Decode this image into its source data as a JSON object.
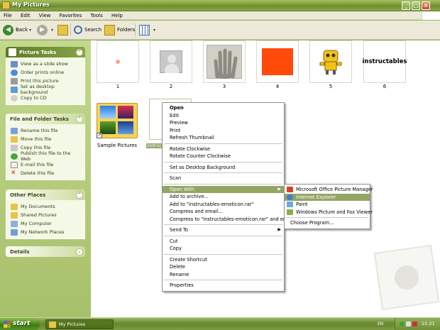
{
  "window": {
    "title": "My Pictures"
  },
  "menubar": {
    "items": [
      "File",
      "Edit",
      "View",
      "Favorites",
      "Tools",
      "Help"
    ]
  },
  "toolbar": {
    "back": "Back",
    "search": "Search",
    "folders": "Folders"
  },
  "tasks": {
    "picture": {
      "title": "Picture Tasks",
      "items": [
        "View as a slide show",
        "Order prints online",
        "Print this picture",
        "Set as desktop background",
        "Copy to CD"
      ]
    },
    "file": {
      "title": "File and Folder Tasks",
      "items": [
        "Rename this file",
        "Move this file",
        "Copy this file",
        "Publish this file to the Web",
        "E-mail this file",
        "Delete this file"
      ]
    },
    "other": {
      "title": "Other Places",
      "items": [
        "My Documents",
        "Shared Pictures",
        "My Computer",
        "My Network Places"
      ]
    },
    "details": {
      "title": "Details"
    }
  },
  "thumbnails": {
    "labels": [
      "1",
      "2",
      "3",
      "4",
      "5",
      "6"
    ],
    "text_6": "instructables",
    "folder_label": "Sample Pictures",
    "selected_label": "instruc"
  },
  "context_menu": {
    "items": [
      "Open",
      "Edit",
      "Preview",
      "Print",
      "Refresh Thumbnail",
      "Rotate Clockwise",
      "Rotate Counter Clockwise",
      "Set as Desktop Background",
      "Scan",
      "Open With",
      "Add to archive...",
      "Add to \"instructables-emoticon.rar\"",
      "Compress and email...",
      "Compress to \"instructables-emoticon.rar\" and email",
      "Send To",
      "Cut",
      "Copy",
      "Create Shortcut",
      "Delete",
      "Rename",
      "Properties"
    ]
  },
  "open_with_menu": {
    "items": [
      "Microsoft Office Picture Manager",
      "Internet Explorer",
      "Paint",
      "Windows Picture and Fax Viewer",
      "Choose Program..."
    ]
  },
  "taskbar": {
    "start": "start",
    "task": "My Pictures",
    "lang": "EN",
    "clock": "15:21"
  },
  "colors": {
    "highlight": "#93a463",
    "title_bar": "#7a9a3a",
    "taskbar": "#6d8d33"
  }
}
